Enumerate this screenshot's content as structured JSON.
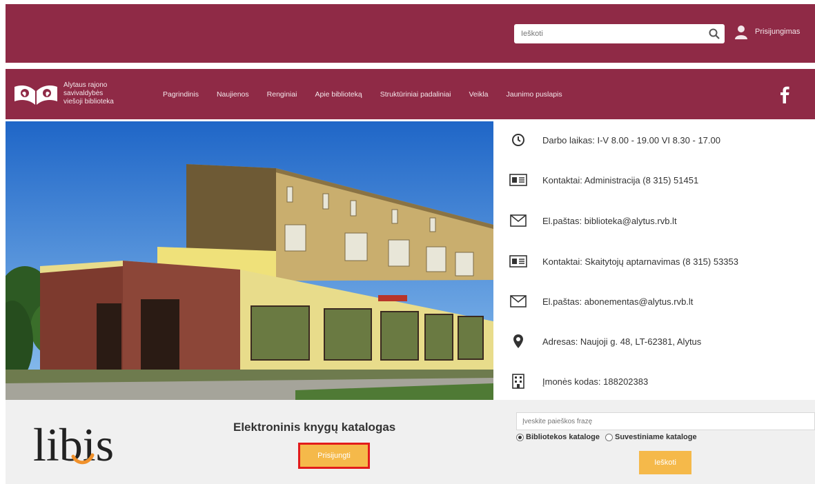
{
  "header": {
    "search_placeholder": "Ieškoti",
    "login_label": "Prisijungimas"
  },
  "library": {
    "name_lines": [
      "Alytaus rajono",
      "savivaldybės",
      "viešoji biblioteka"
    ]
  },
  "nav": {
    "items": [
      {
        "label": "Pagrindinis"
      },
      {
        "label": "Naujienos"
      },
      {
        "label": "Renginiai"
      },
      {
        "label": "Apie biblioteką"
      },
      {
        "label": "Struktūriniai padaliniai"
      },
      {
        "label": "Veikla"
      },
      {
        "label": "Jaunimo puslapis"
      }
    ]
  },
  "info": {
    "rows": [
      {
        "icon": "clock-icon",
        "text": "Darbo laikas: I-V 8.00 - 19.00 VI 8.30 - 17.00"
      },
      {
        "icon": "contact-card-icon",
        "text": "Kontaktai: Administracija (8 315) 51451"
      },
      {
        "icon": "envelope-icon",
        "text": "El.paštas: biblioteka@alytus.rvb.lt"
      },
      {
        "icon": "contact-card-icon",
        "text": "Kontaktai: Skaitytojų aptarnavimas (8 315) 53353"
      },
      {
        "icon": "envelope-icon",
        "text": "El.paštas: abonementas@alytus.rvb.lt"
      },
      {
        "icon": "location-pin-icon",
        "text": "Adresas: Naujoji g. 48, LT-62381, Alytus"
      },
      {
        "icon": "building-icon",
        "text": "Įmonės kodas: 188202383"
      }
    ]
  },
  "catalog": {
    "brand": "libis",
    "title": "Elektroninis knygų katalogas",
    "open_button": "Prisijungti",
    "search_placeholder": "Įveskite paieškos frazę",
    "radio_library": "Bibliotekos kataloge",
    "radio_union": "Suvestiniame kataloge",
    "search_button": "Ieškoti"
  },
  "colors": {
    "brand": "#8f2a46",
    "accent": "#f5b94a",
    "highlight": "#e21b1b"
  }
}
